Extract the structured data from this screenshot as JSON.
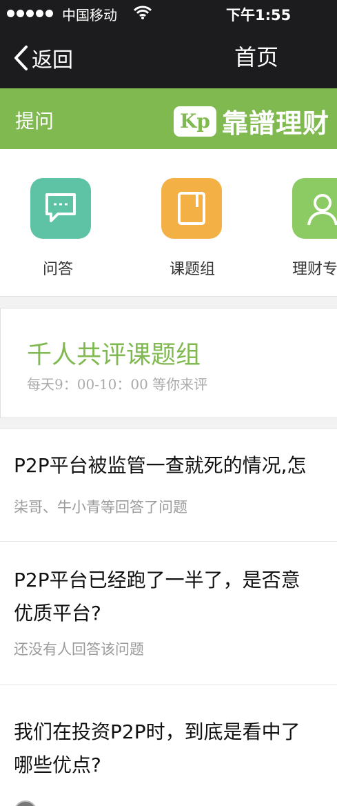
{
  "status_bar": {
    "carrier": "中国移动",
    "time": "下午1:55"
  },
  "nav": {
    "back_label": "返回",
    "title": "首页"
  },
  "header": {
    "ask_label": "提问",
    "brand_logo": "Kp",
    "brand_name": "靠譜理财"
  },
  "quick_links": [
    {
      "label": "问答",
      "icon": "chat-icon",
      "color": "#5ec3a5"
    },
    {
      "label": "课题组",
      "icon": "book-icon",
      "color": "#f3b045"
    },
    {
      "label": "理财专",
      "icon": "person-icon",
      "color": "#8ccb63"
    }
  ],
  "promo": {
    "title": "千人共评课题组",
    "subtitle": "每天9：00-10：00 等你来评"
  },
  "questions": [
    {
      "title_line1": "P2P平台被监管一查就死的情况,怎",
      "title_line2": "",
      "meta": "柒哥、牛小青等回答了问题"
    },
    {
      "title_line1": "P2P平台已经跑了一半了，是否意",
      "title_line2": "优质平台?",
      "meta": "还没有人回答该问题"
    },
    {
      "title_line1": "我们在投资P2P时，到底是看中了",
      "title_line2": "哪些优点?",
      "meta": ""
    }
  ],
  "colors": {
    "brand_green": "#7fb950",
    "topbar": "#1c1c1e"
  }
}
